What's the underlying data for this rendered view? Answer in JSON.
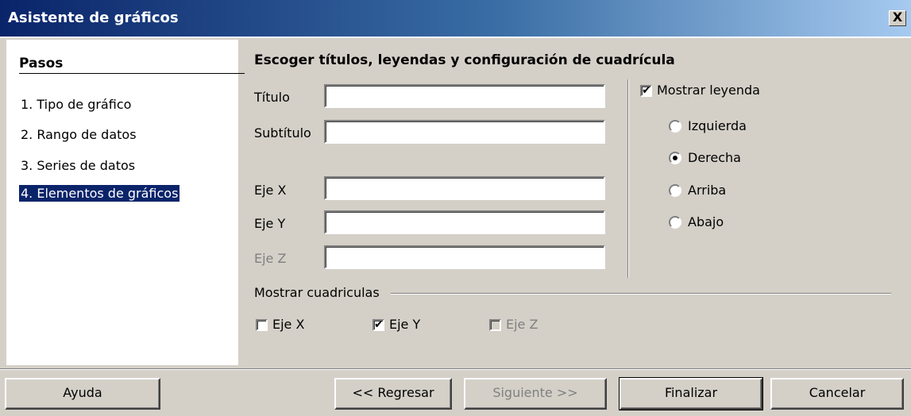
{
  "window": {
    "title": "Asistente de gráficos",
    "close_glyph": "X"
  },
  "steps": {
    "heading": "Pasos",
    "items": [
      {
        "label": "1. Tipo de gráfico"
      },
      {
        "label": "2. Rango de datos"
      },
      {
        "label": "3. Series de datos"
      },
      {
        "label": "4. Elementos de gráficos"
      }
    ]
  },
  "main": {
    "title": "Escoger títulos, leyendas y configuración de cuadrícula",
    "fields": {
      "titulo": {
        "label": "Título",
        "value": ""
      },
      "subtitulo": {
        "label": "Subtítulo",
        "value": ""
      },
      "eje_x": {
        "label": "Eje X",
        "value": ""
      },
      "eje_y": {
        "label": "Eje Y",
        "value": ""
      },
      "eje_z": {
        "label": "Eje Z",
        "value": ""
      }
    },
    "legend": {
      "show_label": "Mostrar leyenda",
      "show_checked": true,
      "options": {
        "izquierda": "Izquierda",
        "derecha": "Derecha",
        "arriba": "Arriba",
        "abajo": "Abajo"
      },
      "selected": "Derecha"
    },
    "grid": {
      "title": "Mostrar cuadriculas",
      "x": {
        "label": "Eje X",
        "checked": false
      },
      "y": {
        "label": "Eje Y",
        "checked": true
      },
      "z": {
        "label": "Eje Z",
        "checked": false,
        "disabled": true
      }
    }
  },
  "buttons": {
    "help": "Ayuda",
    "back": "<< Regresar",
    "next": "Siguiente >>",
    "finish": "Finalizar",
    "cancel": "Cancelar"
  },
  "icons": {
    "check": "✔"
  }
}
